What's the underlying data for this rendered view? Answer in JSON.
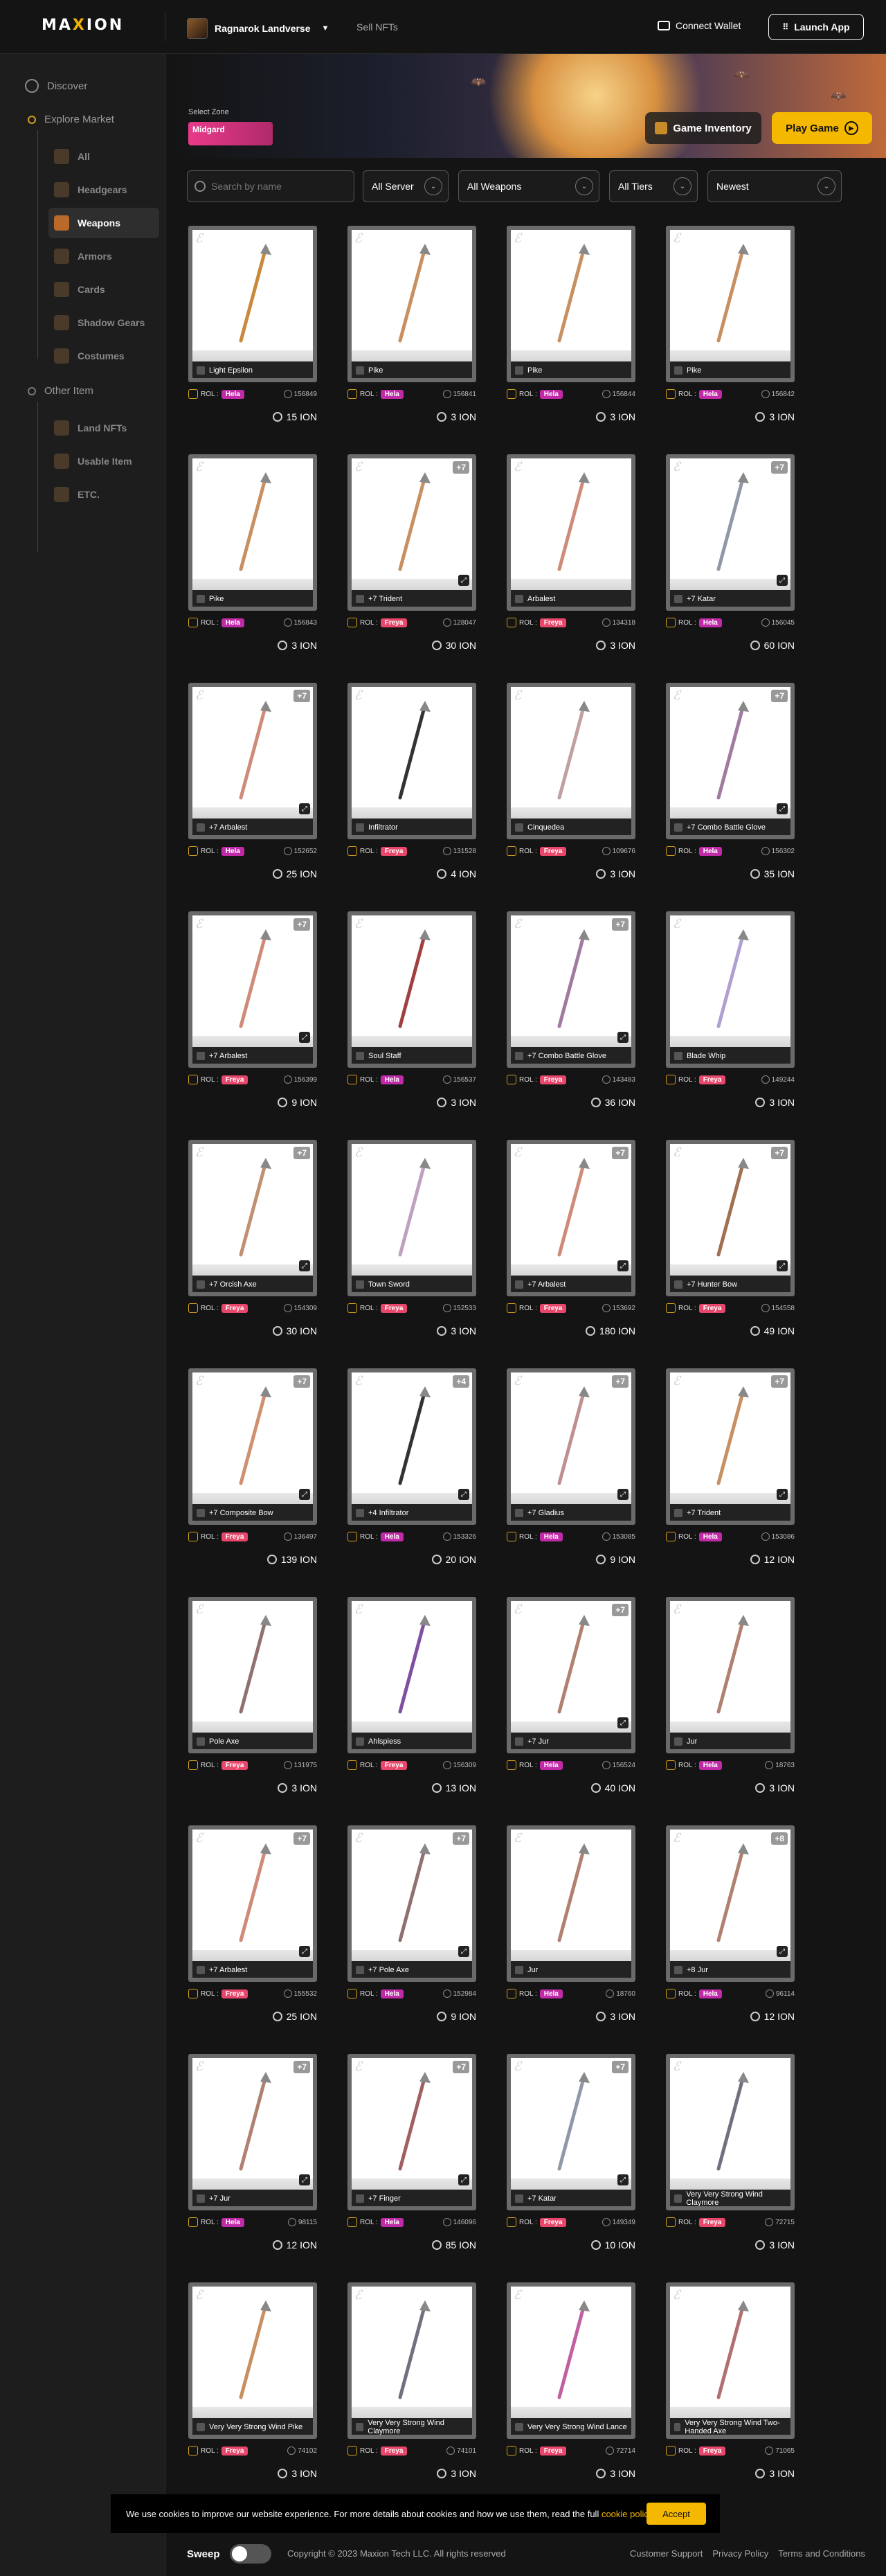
{
  "header": {
    "logo_pre": "MA",
    "logo_x": "X",
    "logo_post": "ION",
    "project": "Ragnarok Landverse",
    "sell": "Sell NFTs",
    "wallet": "Connect Wallet",
    "launch": "Launch App"
  },
  "sidebar": {
    "discover": "Discover",
    "explore": "Explore Market",
    "explore_items": [
      "All",
      "Headgears",
      "Weapons",
      "Armors",
      "Cards",
      "Shadow Gears",
      "Costumes"
    ],
    "other": "Other Item",
    "other_items": [
      "Land NFTs",
      "Usable Item",
      "ETC."
    ]
  },
  "banner": {
    "zone_label": "Select Zone",
    "zone": "Midgard",
    "inventory": "Game Inventory",
    "play": "Play Game"
  },
  "filters": {
    "search_placeholder": "Search by name",
    "server": "All Server",
    "type": "All Weapons",
    "tier": "All Tiers",
    "sort": "Newest"
  },
  "items": [
    {
      "name": "Light Epsilon",
      "server": "Hela",
      "id": "156849",
      "price": "15 ION",
      "lvl": "",
      "tint": "#c88a3a"
    },
    {
      "name": "Pike",
      "server": "Hela",
      "id": "156841",
      "price": "3 ION",
      "lvl": "",
      "tint": "#c89060"
    },
    {
      "name": "Pike",
      "server": "Hela",
      "id": "156844",
      "price": "3 ION",
      "lvl": "",
      "tint": "#c89060"
    },
    {
      "name": "Pike",
      "server": "Hela",
      "id": "156842",
      "price": "3 ION",
      "lvl": "",
      "tint": "#c89060"
    },
    {
      "name": "Pike",
      "server": "Hela",
      "id": "156843",
      "price": "3 ION",
      "lvl": "",
      "tint": "#c89060"
    },
    {
      "name": "+7 Trident",
      "server": "Freya",
      "id": "128047",
      "price": "30 ION",
      "lvl": "+7",
      "tint": "#c89060"
    },
    {
      "name": "Arbalest",
      "server": "Freya",
      "id": "134318",
      "price": "3 ION",
      "lvl": "",
      "tint": "#d08a7a"
    },
    {
      "name": "+7 Katar",
      "server": "Hela",
      "id": "156045",
      "price": "60 ION",
      "lvl": "+7",
      "tint": "#9098a8"
    },
    {
      "name": "+7 Arbalest",
      "server": "Hela",
      "id": "152652",
      "price": "25 ION",
      "lvl": "+7",
      "tint": "#d08a7a"
    },
    {
      "name": "Infiltrator",
      "server": "Freya",
      "id": "131528",
      "price": "4 ION",
      "lvl": "",
      "tint": "#333333"
    },
    {
      "name": "Cinquedea",
      "server": "Freya",
      "id": "109676",
      "price": "3 ION",
      "lvl": "",
      "tint": "#c0a0a0"
    },
    {
      "name": "+7 Combo Battle Glove",
      "server": "Hela",
      "id": "156302",
      "price": "35 ION",
      "lvl": "+7",
      "tint": "#a07aa0"
    },
    {
      "name": "+7 Arbalest",
      "server": "Freya",
      "id": "156399",
      "price": "9 ION",
      "lvl": "+7",
      "tint": "#d08a7a"
    },
    {
      "name": "Soul Staff",
      "server": "Hela",
      "id": "156537",
      "price": "3 ION",
      "lvl": "",
      "tint": "#a04040"
    },
    {
      "name": "+7 Combo Battle Glove",
      "server": "Freya",
      "id": "143483",
      "price": "36 ION",
      "lvl": "+7",
      "tint": "#a07aa0"
    },
    {
      "name": "Blade Whip",
      "server": "Freya",
      "id": "149244",
      "price": "3 ION",
      "lvl": "",
      "tint": "#b0a0d0"
    },
    {
      "name": "+7 Orcish Axe",
      "server": "Freya",
      "id": "154309",
      "price": "30 ION",
      "lvl": "+7",
      "tint": "#c09070"
    },
    {
      "name": "Town Sword",
      "server": "Freya",
      "id": "152533",
      "price": "3 ION",
      "lvl": "",
      "tint": "#c0a0c0"
    },
    {
      "name": "+7 Arbalest",
      "server": "Freya",
      "id": "153692",
      "price": "180 ION",
      "lvl": "+7",
      "tint": "#d08a7a"
    },
    {
      "name": "+7 Hunter Bow",
      "server": "Freya",
      "id": "154558",
      "price": "49 ION",
      "lvl": "+7",
      "tint": "#a07050"
    },
    {
      "name": "+7 Composite Bow",
      "server": "Freya",
      "id": "136497",
      "price": "139 ION",
      "lvl": "+7",
      "tint": "#d09070"
    },
    {
      "name": "+4 Infiltrator",
      "server": "Hela",
      "id": "153326",
      "price": "20 ION",
      "lvl": "+4",
      "tint": "#333333"
    },
    {
      "name": "+7 Gladius",
      "server": "Hela",
      "id": "153085",
      "price": "9 ION",
      "lvl": "+7",
      "tint": "#c09090"
    },
    {
      "name": "+7 Trident",
      "server": "Hela",
      "id": "153086",
      "price": "12 ION",
      "lvl": "+7",
      "tint": "#c89060"
    },
    {
      "name": "Pole Axe",
      "server": "Freya",
      "id": "131975",
      "price": "3 ION",
      "lvl": "",
      "tint": "#907070"
    },
    {
      "name": "Ahlspiess",
      "server": "Freya",
      "id": "156309",
      "price": "13 ION",
      "lvl": "",
      "tint": "#8050a0"
    },
    {
      "name": "+7 Jur",
      "server": "Hela",
      "id": "156524",
      "price": "40 ION",
      "lvl": "+7",
      "tint": "#b08070"
    },
    {
      "name": "Jur",
      "server": "Hela",
      "id": "18763",
      "price": "3 ION",
      "lvl": "",
      "tint": "#b08070"
    },
    {
      "name": "+7 Arbalest",
      "server": "Freya",
      "id": "155532",
      "price": "25 ION",
      "lvl": "+7",
      "tint": "#d08a7a"
    },
    {
      "name": "+7 Pole Axe",
      "server": "Hela",
      "id": "152984",
      "price": "9 ION",
      "lvl": "+7",
      "tint": "#907070"
    },
    {
      "name": "Jur",
      "server": "Hela",
      "id": "18760",
      "price": "3 ION",
      "lvl": "",
      "tint": "#b08070"
    },
    {
      "name": "+8 Jur",
      "server": "Hela",
      "id": "96114",
      "price": "12 ION",
      "lvl": "+8",
      "tint": "#b08070"
    },
    {
      "name": "+7 Jur",
      "server": "Hela",
      "id": "98115",
      "price": "12 ION",
      "lvl": "+7",
      "tint": "#b08070"
    },
    {
      "name": "+7 Finger",
      "server": "Hela",
      "id": "146096",
      "price": "85 ION",
      "lvl": "+7",
      "tint": "#a06060"
    },
    {
      "name": "+7 Katar",
      "server": "Freya",
      "id": "149349",
      "price": "10 ION",
      "lvl": "+7",
      "tint": "#9098a8"
    },
    {
      "name": "Very Very Strong Wind Claymore",
      "server": "Freya",
      "id": "72715",
      "price": "3 ION",
      "lvl": "",
      "tint": "#707080"
    },
    {
      "name": "Very Very Strong Wind Pike",
      "server": "Freya",
      "id": "74102",
      "price": "3 ION",
      "lvl": "",
      "tint": "#c89060"
    },
    {
      "name": "Very Very Strong Wind Claymore",
      "server": "Freya",
      "id": "74101",
      "price": "3 ION",
      "lvl": "",
      "tint": "#707080"
    },
    {
      "name": "Very Very Strong Wind Lance",
      "server": "Freya",
      "id": "72714",
      "price": "3 ION",
      "lvl": "",
      "tint": "#c060a0"
    },
    {
      "name": "Very Very Strong Wind Two-Handed Axe",
      "server": "Freya",
      "id": "71065",
      "price": "3 ION",
      "lvl": "",
      "tint": "#b07070"
    }
  ],
  "roi_label": "ROL :",
  "cookie": {
    "text": "We use cookies to improve our website experience. For more details about cookies and how we use them, read the full ",
    "link": "cookie policy.",
    "accept": "Accept"
  },
  "footer": {
    "sweep": "Sweep",
    "copyright": "Copyright © 2023 Maxion Tech LLC. All rights reserved",
    "links": [
      "Customer Support",
      "Privacy Policy",
      "Terms and Conditions"
    ]
  }
}
